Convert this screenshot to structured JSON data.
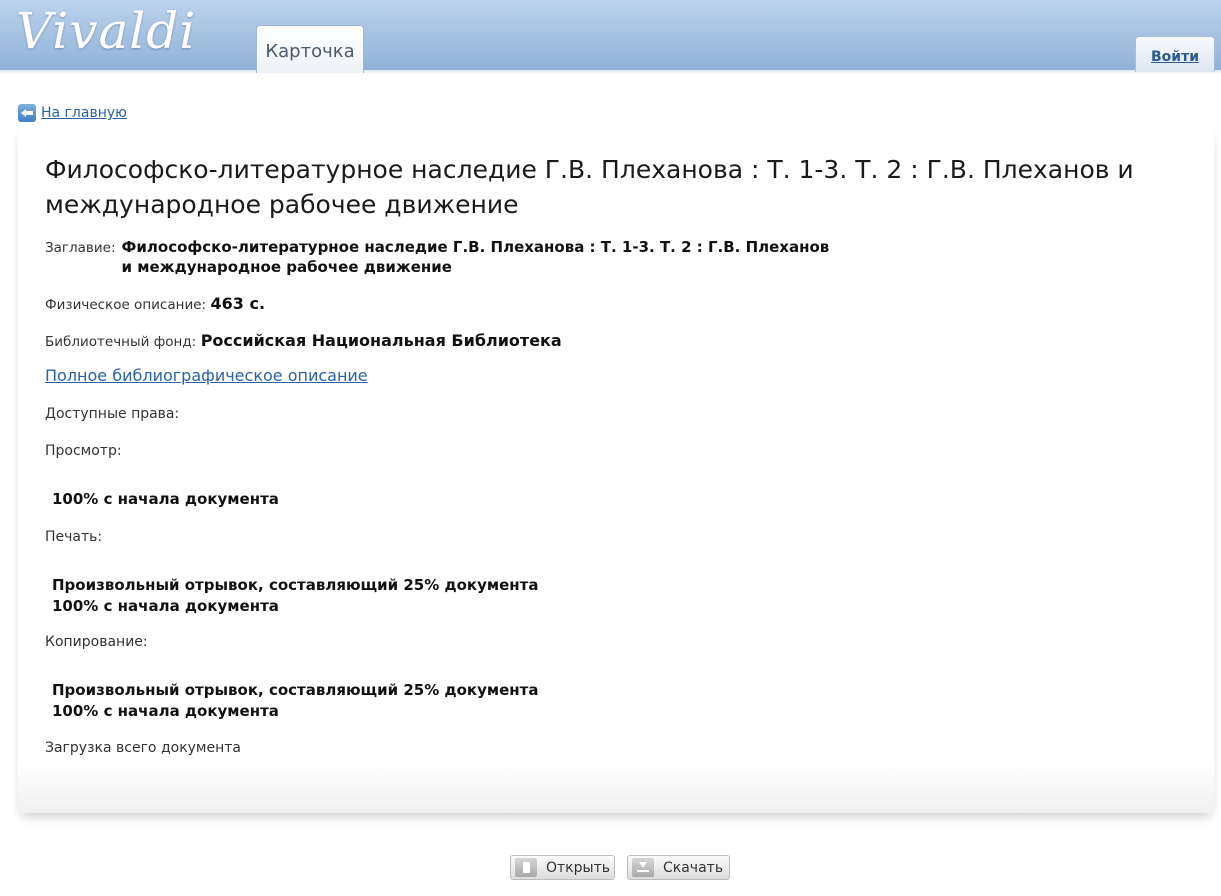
{
  "header": {
    "logo": "Vivaldi",
    "tab_label": "Карточка",
    "login_label": "Войти"
  },
  "nav": {
    "back_label": "На главную"
  },
  "record": {
    "title": "Философско-литературное наследие Г.В. Плеханова : Т. 1-3. Т. 2 : Г.В. Плеханов и международное рабочее движение",
    "fields": {
      "title_label": "Заглавие:",
      "title_value_line1": "Философско-литературное наследие Г.В. Плеханова : Т. 1-3. Т. 2 : Г.В. Плеханов",
      "title_value_line2": "и международное рабочее движение",
      "physical_label": "Физическое описание:",
      "physical_value": "463 с.",
      "fund_label": "Библиотечный фонд:",
      "fund_value": "Российская Национальная Библиотека"
    },
    "full_description_link": "Полное библиографическое описание",
    "rights": {
      "heading": "Доступные права:",
      "view_label": "Просмотр:",
      "view_items": [
        "100% с начала документа"
      ],
      "print_label": "Печать:",
      "print_items": [
        "Произвольный отрывок, составляющий 25% документа",
        "100% с начала документа"
      ],
      "copy_label": "Копирование:",
      "copy_items": [
        "Произвольный отрывок, составляющий 25% документа",
        "100% с начала документа"
      ],
      "download_label": "Загрузка всего документа"
    }
  },
  "actions": {
    "open_label": "Открыть",
    "download_label": "Скачать"
  }
}
